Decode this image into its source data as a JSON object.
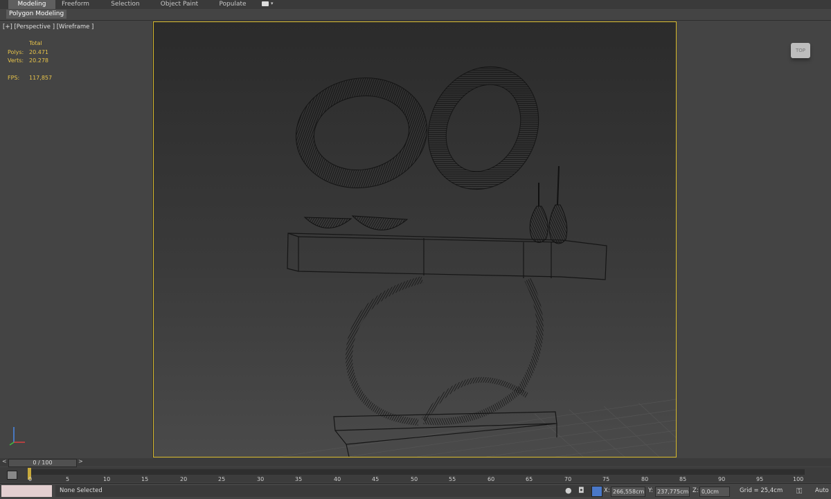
{
  "ribbon": {
    "tabs": [
      {
        "label": "Modeling",
        "active": true
      },
      {
        "label": "Freeform"
      },
      {
        "label": "Selection"
      },
      {
        "label": "Object Paint"
      },
      {
        "label": "Populate"
      }
    ],
    "sub_tab": "Polygon Modeling"
  },
  "viewport": {
    "label": "[+] [Perspective ] [Wireframe ]",
    "stats": {
      "header": "Total",
      "polys_label": "Polys:",
      "polys_value": "20.471",
      "verts_label": "Verts:",
      "verts_value": "20.278",
      "fps_label": "FPS:",
      "fps_value": "117,857"
    },
    "border_color": "#d7b92a",
    "viewcube_label": "TOP"
  },
  "timeline": {
    "frame_counter": "0 / 100",
    "prev_arrow": "<",
    "next_arrow": ">",
    "ticks": [
      "0",
      "5",
      "10",
      "15",
      "20",
      "25",
      "30",
      "35",
      "40",
      "45",
      "50",
      "55",
      "60",
      "65",
      "70",
      "75",
      "80",
      "85",
      "90",
      "95",
      "100"
    ]
  },
  "status": {
    "selection": "None Selected",
    "x_label": "X:",
    "x_value": "266,558cm",
    "y_label": "Y:",
    "y_value": "237,775cm",
    "z_label": "Z:",
    "z_value": "0,0cm",
    "grid": "Grid = 25,4cm",
    "auto": "Auto"
  },
  "icons": [
    "camera-icon",
    "dropdown-arrow-icon",
    "layer-manager-icon",
    "keyframe-marker-icon",
    "pin-icon",
    "lock-icon",
    "absolute-mode-icon",
    "key-icon",
    "axis-gizmo-icon",
    "viewcube-icon"
  ]
}
